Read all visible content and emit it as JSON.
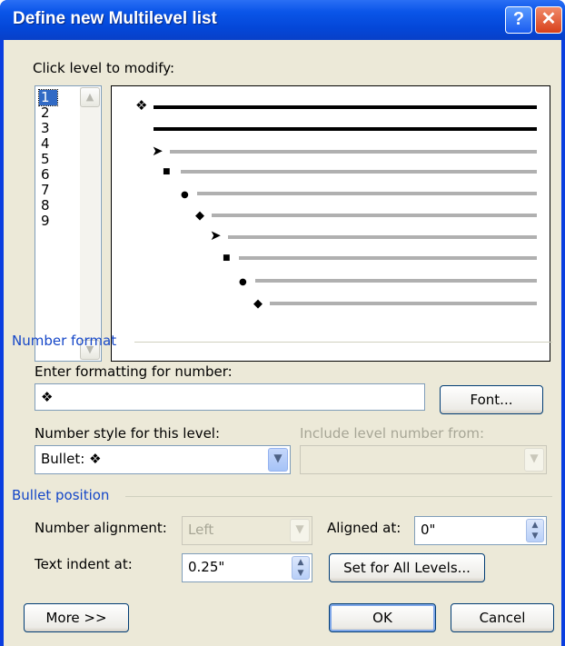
{
  "window": {
    "title": "Define new Multilevel list",
    "help_glyph": "?",
    "close_glyph": "✕"
  },
  "levels": {
    "label": "Click level to modify:",
    "items": [
      "1",
      "2",
      "3",
      "4",
      "5",
      "6",
      "7",
      "8",
      "9"
    ],
    "selected": "1"
  },
  "preview": {
    "bullets": [
      "❖",
      "➤",
      "■",
      "●",
      "◆",
      "➤",
      "■",
      "●",
      "◆"
    ]
  },
  "number_format": {
    "title": "Number format",
    "enter_label": "Enter formatting for number:",
    "format_value": "❖",
    "font_button": "Font...",
    "style_label": "Number style for this level:",
    "style_value": "Bullet:  ❖",
    "include_label": "Include level number from:",
    "include_value": ""
  },
  "bullet_position": {
    "title": "Bullet position",
    "alignment_label": "Number alignment:",
    "alignment_value": "Left",
    "aligned_at_label": "Aligned at:",
    "aligned_at_value": "0\"",
    "indent_label": "Text indent at:",
    "indent_value": "0.25\"",
    "set_all_button": "Set for All Levels..."
  },
  "footer": {
    "more_button": "More >>",
    "ok_button": "OK",
    "cancel_button": "Cancel"
  },
  "colors": {
    "title_bar": "#0a55e8",
    "dialog_bg": "#ece9d8",
    "group_title": "#1547c8",
    "selection": "#316ac5"
  }
}
